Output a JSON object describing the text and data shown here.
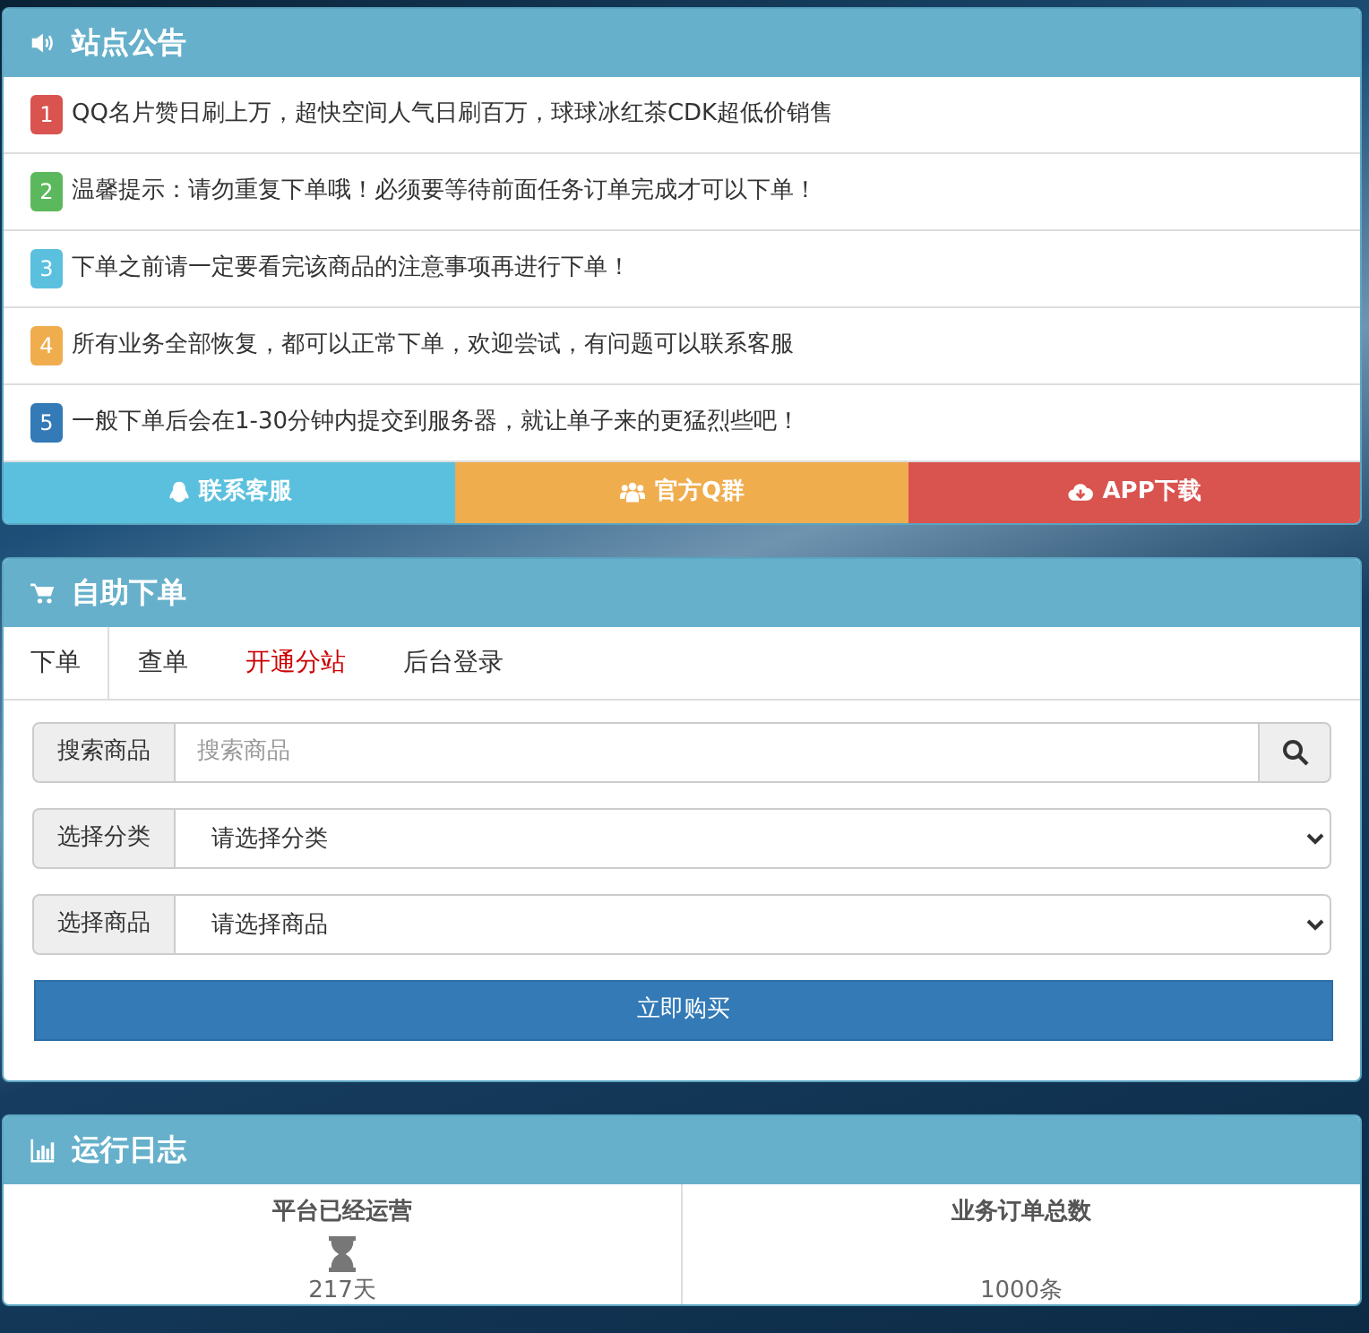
{
  "notice_panel": {
    "title": "站点公告",
    "items": [
      {
        "number": "1",
        "text": "QQ名片赞日刷上万，超快空间人气日刷百万，球球冰红茶CDK超低价销售",
        "color": "#d9534f"
      },
      {
        "number": "2",
        "text": "温馨提示：请勿重复下单哦！必须要等待前面任务订单完成才可以下单！",
        "color": "#5cb85c"
      },
      {
        "number": "3",
        "text": "下单之前请一定要看完该商品的注意事项再进行下单！",
        "color": "#5bc0de"
      },
      {
        "number": "4",
        "text": "所有业务全部恢复，都可以正常下单，欢迎尝试，有问题可以联系客服",
        "color": "#f0ad4e"
      },
      {
        "number": "5",
        "text": "一般下单后会在1-30分钟内提交到服务器，就让单子来的更猛烈些吧！",
        "color": "#337ab7"
      }
    ],
    "buttons": [
      {
        "kind": "support",
        "label": "联系客服",
        "color": "#5bc0de"
      },
      {
        "kind": "group",
        "label": "官方Q群",
        "color": "#f0ad4e"
      },
      {
        "kind": "download",
        "label": "APP下载",
        "color": "#d9534f"
      }
    ]
  },
  "order_panel": {
    "title": "自助下单",
    "tabs": [
      {
        "label": "下单",
        "selected": true,
        "color": "#333333"
      },
      {
        "label": "查单",
        "selected": false,
        "color": "#333333"
      },
      {
        "label": "开通分站",
        "selected": false,
        "color": "#cc0000"
      },
      {
        "label": "后台登录",
        "selected": false,
        "color": "#333333"
      }
    ],
    "search": {
      "label": "搜索商品",
      "placeholder": "搜索商品"
    },
    "selects": [
      {
        "label": "选择分类",
        "value": "请选择分类"
      },
      {
        "label": "选择商品",
        "value": "请选择商品"
      }
    ],
    "buy_button": "立即购买"
  },
  "log_panel": {
    "title": "运行日志",
    "stats": [
      {
        "kind": "uptime",
        "label": "平台已经运营",
        "value": "217天"
      },
      {
        "kind": "orders",
        "label": "业务订单总数",
        "value": "1000条"
      }
    ]
  }
}
